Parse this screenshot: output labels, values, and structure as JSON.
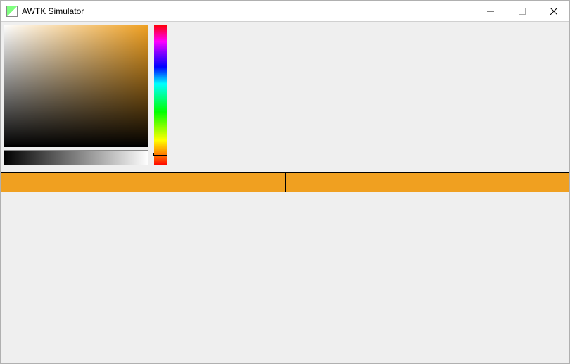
{
  "window": {
    "title": "AWTK Simulator"
  },
  "colorPicker": {
    "selectedColor": "#f0a020",
    "hue": 36,
    "saturation": 0,
    "value": 0
  },
  "bars": {
    "leftColor": "#f0a020",
    "rightColor": "#f0a020"
  }
}
